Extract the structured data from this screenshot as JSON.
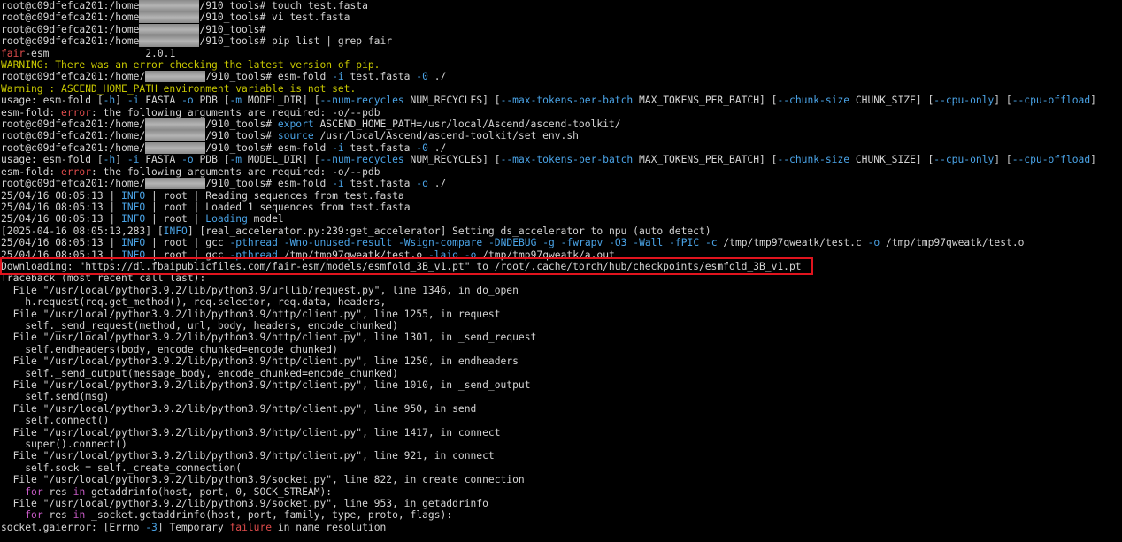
{
  "terminal": {
    "highlight_color": "#e0141e",
    "lines": [
      [
        {
          "t": "root@c09dfefca201:/home"
        },
        {
          "r": true
        },
        {
          "t": "/910_tools# touch test.fasta"
        }
      ],
      [
        {
          "t": "root@c09dfefca201:/home"
        },
        {
          "r": true
        },
        {
          "t": "/910_tools# vi test.fasta"
        }
      ],
      [
        {
          "t": "root@c09dfefca201:/home"
        },
        {
          "r": true
        },
        {
          "t": "/910_tools#"
        }
      ],
      [
        {
          "t": "root@c09dfefca201:/home"
        },
        {
          "r": true
        },
        {
          "t": "/910_tools# pip list | grep fair"
        }
      ],
      [
        {
          "t": "fair",
          "c": "red"
        },
        {
          "t": "-esm                2.0.1"
        }
      ],
      [
        {
          "t": "WARNING: There was an error checking the latest version of pip.",
          "c": "yellow"
        }
      ],
      [
        {
          "t": "root@c09dfefca201:/home/"
        },
        {
          "r": true
        },
        {
          "t": "/910_tools# esm-fold "
        },
        {
          "t": "-i",
          "c": "blue"
        },
        {
          "t": " test.fasta "
        },
        {
          "t": "-0",
          "c": "blue"
        },
        {
          "t": " ./"
        }
      ],
      [
        {
          "t": "Warning : ASCEND_HOME_PATH environment variable is not set.",
          "c": "yellow"
        }
      ],
      [
        {
          "t": "usage: esm-fold ["
        },
        {
          "t": "-h",
          "c": "blue"
        },
        {
          "t": "] "
        },
        {
          "t": "-i",
          "c": "blue"
        },
        {
          "t": " FASTA "
        },
        {
          "t": "-o",
          "c": "blue"
        },
        {
          "t": " PDB ["
        },
        {
          "t": "-m",
          "c": "blue"
        },
        {
          "t": " MODEL_DIR] ["
        },
        {
          "t": "--num-recycles",
          "c": "blue"
        },
        {
          "t": " NUM_RECYCLES] ["
        },
        {
          "t": "--max-tokens-per-batch",
          "c": "blue"
        },
        {
          "t": " MAX_TOKENS_PER_BATCH] ["
        },
        {
          "t": "--chunk-size",
          "c": "blue"
        },
        {
          "t": " CHUNK_SIZE] ["
        },
        {
          "t": "--cpu-only",
          "c": "blue"
        },
        {
          "t": "] ["
        },
        {
          "t": "--cpu-offload",
          "c": "blue"
        },
        {
          "t": "]"
        }
      ],
      [
        {
          "t": "esm-fold: "
        },
        {
          "t": "error",
          "c": "red"
        },
        {
          "t": ": the following arguments are required: -o/--pdb"
        }
      ],
      [
        {
          "t": "root@c09dfefca201:/home/"
        },
        {
          "r": true
        },
        {
          "t": "/910_tools# "
        },
        {
          "t": "export",
          "c": "blue"
        },
        {
          "t": " ASCEND_HOME_PATH=/usr/local/Ascend/ascend-toolkit/"
        }
      ],
      [
        {
          "t": "root@c09dfefca201:/home/"
        },
        {
          "r": true
        },
        {
          "t": "/910_tools# "
        },
        {
          "t": "source",
          "c": "blue"
        },
        {
          "t": " /usr/local/Ascend/ascend-toolkit/set_env.sh"
        }
      ],
      [
        {
          "t": "root@c09dfefca201:/home/"
        },
        {
          "r": true
        },
        {
          "t": "/910_tools# esm-fold "
        },
        {
          "t": "-i",
          "c": "blue"
        },
        {
          "t": " test.fasta "
        },
        {
          "t": "-0",
          "c": "blue"
        },
        {
          "t": " ./"
        }
      ],
      [
        {
          "t": "usage: esm-fold ["
        },
        {
          "t": "-h",
          "c": "blue"
        },
        {
          "t": "] "
        },
        {
          "t": "-i",
          "c": "blue"
        },
        {
          "t": " FASTA "
        },
        {
          "t": "-o",
          "c": "blue"
        },
        {
          "t": " PDB ["
        },
        {
          "t": "-m",
          "c": "blue"
        },
        {
          "t": " MODEL_DIR] ["
        },
        {
          "t": "--num-recycles",
          "c": "blue"
        },
        {
          "t": " NUM_RECYCLES] ["
        },
        {
          "t": "--max-tokens-per-batch",
          "c": "blue"
        },
        {
          "t": " MAX_TOKENS_PER_BATCH] ["
        },
        {
          "t": "--chunk-size",
          "c": "blue"
        },
        {
          "t": " CHUNK_SIZE] ["
        },
        {
          "t": "--cpu-only",
          "c": "blue"
        },
        {
          "t": "] ["
        },
        {
          "t": "--cpu-offload",
          "c": "blue"
        },
        {
          "t": "]"
        }
      ],
      [
        {
          "t": "esm-fold: "
        },
        {
          "t": "error",
          "c": "red"
        },
        {
          "t": ": the following arguments are required: -o/--pdb"
        }
      ],
      [
        {
          "t": "root@c09dfefca201:/home/"
        },
        {
          "r": true
        },
        {
          "t": "/910_tools# esm-fold "
        },
        {
          "t": "-i",
          "c": "blue"
        },
        {
          "t": " test.fasta "
        },
        {
          "t": "-o",
          "c": "blue"
        },
        {
          "t": " ./"
        }
      ],
      [
        {
          "t": "25/04/16 08:05:13 | "
        },
        {
          "t": "INFO",
          "c": "blue"
        },
        {
          "t": " | root | Reading sequences from test.fasta"
        }
      ],
      [
        {
          "t": "25/04/16 08:05:13 | "
        },
        {
          "t": "INFO",
          "c": "blue"
        },
        {
          "t": " | root | Loaded 1 sequences from test.fasta"
        }
      ],
      [
        {
          "t": "25/04/16 08:05:13 | "
        },
        {
          "t": "INFO",
          "c": "blue"
        },
        {
          "t": " | root | "
        },
        {
          "t": "Loading",
          "c": "blue"
        },
        {
          "t": " model"
        }
      ],
      [
        {
          "t": "[2025-04-16 08:05:13,283] ["
        },
        {
          "t": "INFO",
          "c": "blue"
        },
        {
          "t": "] [real_accelerator.py:239:get_accelerator] Setting ds_accelerator to npu (auto detect)"
        }
      ],
      [
        {
          "t": "25/04/16 08:05:13 | "
        },
        {
          "t": "INFO",
          "c": "blue"
        },
        {
          "t": " | root | gcc "
        },
        {
          "t": "-pthread",
          "c": "blue"
        },
        {
          "t": " "
        },
        {
          "t": "-Wno-unused-result",
          "c": "blue"
        },
        {
          "t": " "
        },
        {
          "t": "-Wsign-compare",
          "c": "blue"
        },
        {
          "t": " "
        },
        {
          "t": "-DNDEBUG",
          "c": "blue"
        },
        {
          "t": " "
        },
        {
          "t": "-g",
          "c": "blue"
        },
        {
          "t": " "
        },
        {
          "t": "-fwrapv",
          "c": "blue"
        },
        {
          "t": " "
        },
        {
          "t": "-O3",
          "c": "blue"
        },
        {
          "t": " "
        },
        {
          "t": "-Wall",
          "c": "blue"
        },
        {
          "t": " "
        },
        {
          "t": "-fPIC",
          "c": "blue"
        },
        {
          "t": " "
        },
        {
          "t": "-c",
          "c": "blue"
        },
        {
          "t": " /tmp/tmp97qweatk/test.c "
        },
        {
          "t": "-o",
          "c": "blue"
        },
        {
          "t": " /tmp/tmp97qweatk/test.o"
        }
      ],
      [
        {
          "t": "25/04/16 08:05:13 | "
        },
        {
          "t": "INFO",
          "c": "blue"
        },
        {
          "t": " | root | gcc "
        },
        {
          "t": "-pthread",
          "c": "blue"
        },
        {
          "t": " /tmp/tmp97qweatk/test.o "
        },
        {
          "t": "-laio",
          "c": "blue"
        },
        {
          "t": " "
        },
        {
          "t": "-o",
          "c": "blue"
        },
        {
          "t": " /tmp/tmp97qweatk/a.out"
        }
      ],
      [
        {
          "t": "Downloading: \""
        },
        {
          "t": "https://dl.fbaipublicfiles.com/fair-esm/models/esmfold_3B_v1.pt",
          "c": "url"
        },
        {
          "t": "\" to /root/.cache/torch/hub/checkpoints/esmfold_3B_v1.pt"
        }
      ],
      [
        {
          "t": "Traceback (most recent call last):"
        }
      ],
      [
        {
          "t": "  File \"/usr/local/python3.9.2/lib/python3.9/urllib/request.py\", line 1346, in do_open"
        }
      ],
      [
        {
          "t": "    h.request(req.get_method(), req.selector, req.data, headers,"
        }
      ],
      [
        {
          "t": "  File \"/usr/local/python3.9.2/lib/python3.9/http/client.py\", line 1255, in request"
        }
      ],
      [
        {
          "t": "    self._send_request(method, url, body, headers, encode_chunked)"
        }
      ],
      [
        {
          "t": "  File \"/usr/local/python3.9.2/lib/python3.9/http/client.py\", line 1301, in _send_request"
        }
      ],
      [
        {
          "t": "    self.endheaders(body, encode_chunked=encode_chunked)"
        }
      ],
      [
        {
          "t": "  File \"/usr/local/python3.9.2/lib/python3.9/http/client.py\", line 1250, in endheaders"
        }
      ],
      [
        {
          "t": "    self._send_output(message_body, encode_chunked=encode_chunked)"
        }
      ],
      [
        {
          "t": "  File \"/usr/local/python3.9.2/lib/python3.9/http/client.py\", line 1010, in _send_output"
        }
      ],
      [
        {
          "t": "    self.send(msg)"
        }
      ],
      [
        {
          "t": "  File \"/usr/local/python3.9.2/lib/python3.9/http/client.py\", line 950, in send"
        }
      ],
      [
        {
          "t": "    self.connect()"
        }
      ],
      [
        {
          "t": "  File \"/usr/local/python3.9.2/lib/python3.9/http/client.py\", line 1417, in connect"
        }
      ],
      [
        {
          "t": "    super().connect()"
        }
      ],
      [
        {
          "t": "  File \"/usr/local/python3.9.2/lib/python3.9/http/client.py\", line 921, in connect"
        }
      ],
      [
        {
          "t": "    self.sock = self._create_connection("
        }
      ],
      [
        {
          "t": "  File \"/usr/local/python3.9.2/lib/python3.9/socket.py\", line 822, in create_connection"
        }
      ],
      [
        {
          "t": "    "
        },
        {
          "t": "for",
          "c": "magenta"
        },
        {
          "t": " res "
        },
        {
          "t": "in",
          "c": "magenta"
        },
        {
          "t": " getaddrinfo(host, port, 0, SOCK_STREAM):"
        }
      ],
      [
        {
          "t": "  File \"/usr/local/python3.9.2/lib/python3.9/socket.py\", line 953, in getaddrinfo"
        }
      ],
      [
        {
          "t": "    "
        },
        {
          "t": "for",
          "c": "magenta"
        },
        {
          "t": " res "
        },
        {
          "t": "in",
          "c": "magenta"
        },
        {
          "t": " _socket.getaddrinfo(host, port, family, type, proto, flags):"
        }
      ],
      [
        {
          "t": "socket.gaierror: [Errno "
        },
        {
          "t": "-3",
          "c": "blue"
        },
        {
          "t": "] Temporary "
        },
        {
          "t": "failure",
          "c": "red"
        },
        {
          "t": " in name resolution"
        }
      ]
    ]
  }
}
